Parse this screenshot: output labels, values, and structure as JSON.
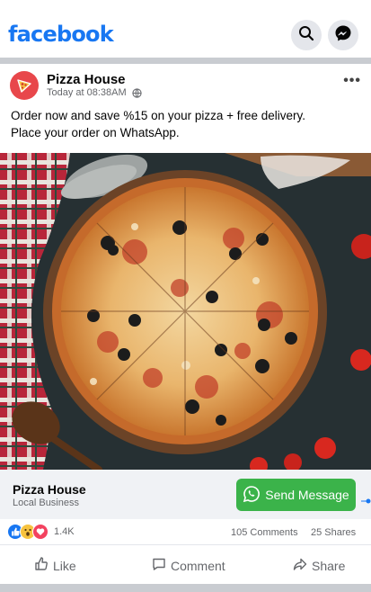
{
  "app": {
    "logo_text": "facebook",
    "brand_color": "#1877f2"
  },
  "header_icons": [
    "search-icon",
    "messenger-icon"
  ],
  "post": {
    "page_name": "Pizza House",
    "timestamp": "Today at 08:38AM",
    "audience_icon": "globe-icon",
    "text_line1": "Order now and save %15 on your pizza + free delivery.",
    "text_line2": "Place your order on WhatsApp.",
    "image": "pizza-photo"
  },
  "link_bar": {
    "title": "Pizza House",
    "subtitle": "Local Business",
    "cta_label": "Send Message",
    "cta_icon": "whatsapp-icon",
    "cta_color": "#3bb34a"
  },
  "stats": {
    "reaction_icons": [
      "like-icon",
      "wow-icon",
      "love-icon"
    ],
    "reaction_count": "1.4K",
    "comments": "105 Comments",
    "shares": "25 Shares"
  },
  "actions": {
    "like": "Like",
    "comment": "Comment",
    "share": "Share"
  }
}
